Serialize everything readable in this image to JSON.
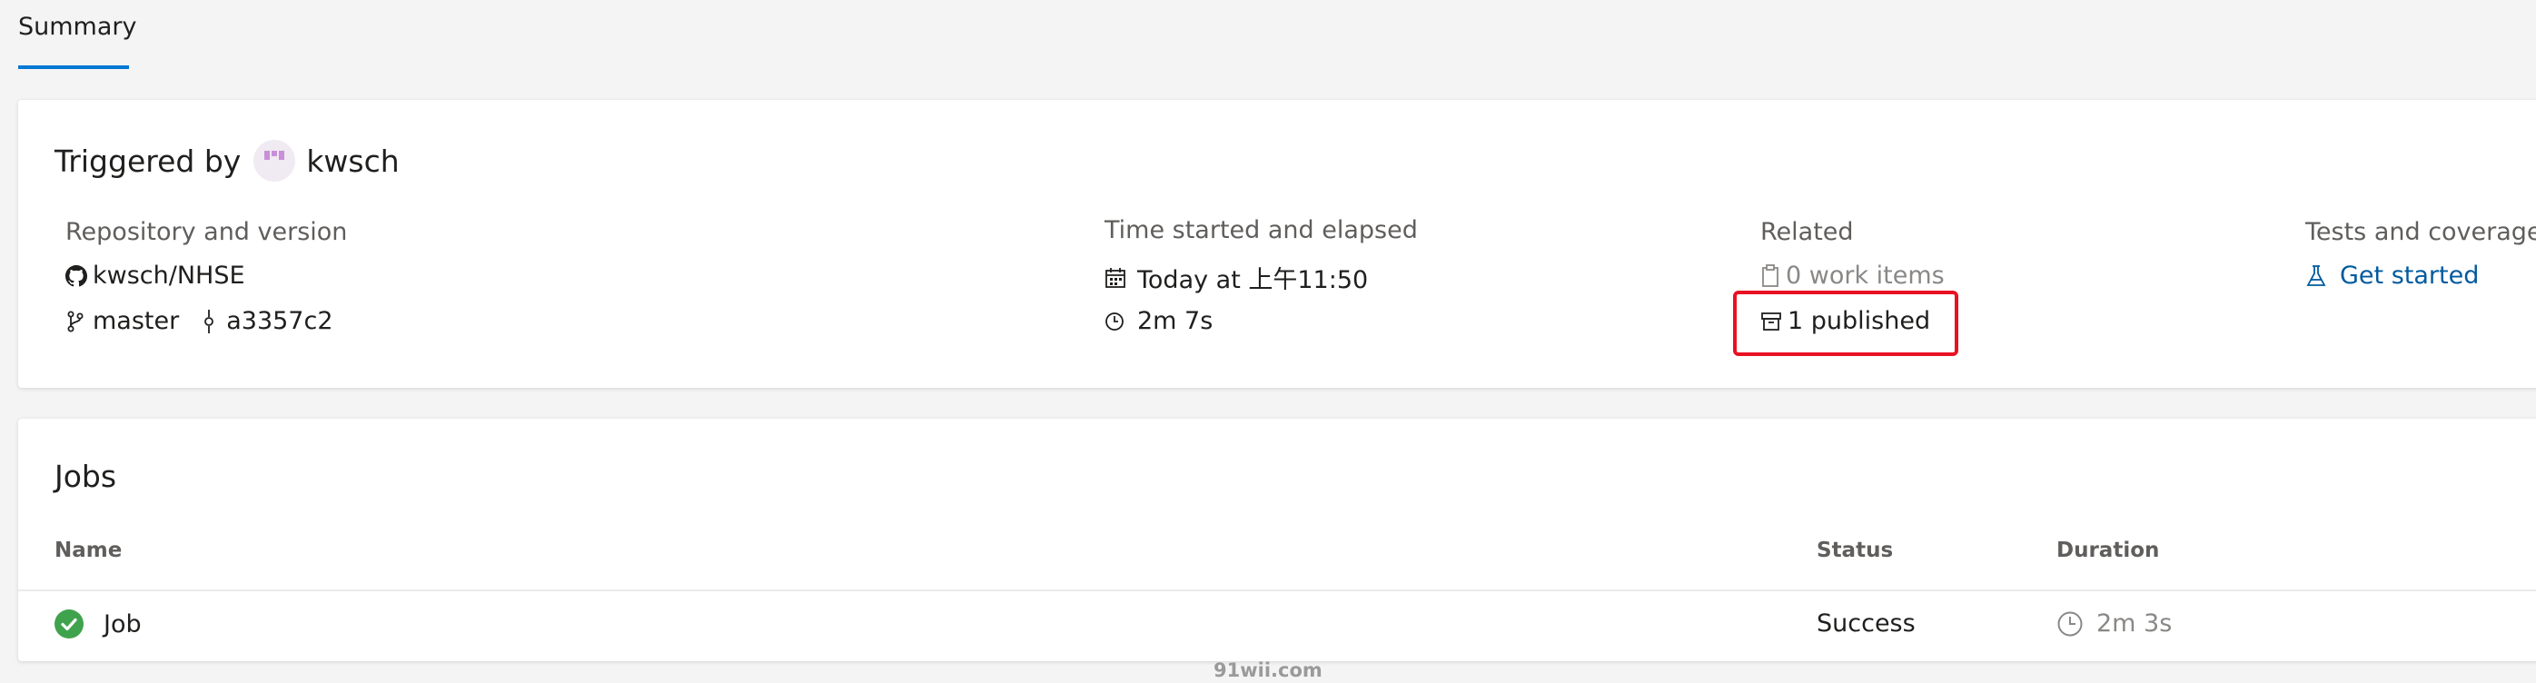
{
  "tabs": [
    {
      "label": "Summary",
      "active": true
    }
  ],
  "summary": {
    "triggered_prefix": "Triggered by",
    "triggered_user": "kwsch",
    "repository": {
      "label": "Repository and version",
      "repo": "kwsch/NHSE",
      "branch": "master",
      "commit": "a3357c2"
    },
    "time": {
      "label": "Time started and elapsed",
      "started": "Today at 上午11:50",
      "elapsed": "2m 7s"
    },
    "related": {
      "label": "Related",
      "work_items": "0 work items",
      "published": "1 published"
    },
    "tests": {
      "label": "Tests and coverage",
      "link": "Get started"
    }
  },
  "jobs": {
    "title": "Jobs",
    "columns": [
      "Name",
      "Status",
      "Duration"
    ],
    "rows": [
      {
        "name": "Job",
        "status": "Success",
        "duration": "2m 3s"
      }
    ]
  },
  "watermark": "91wii.com",
  "colors": {
    "accent": "#0078d4",
    "success": "#3fa34d",
    "highlight": "#e81123",
    "link": "#005a9e"
  }
}
